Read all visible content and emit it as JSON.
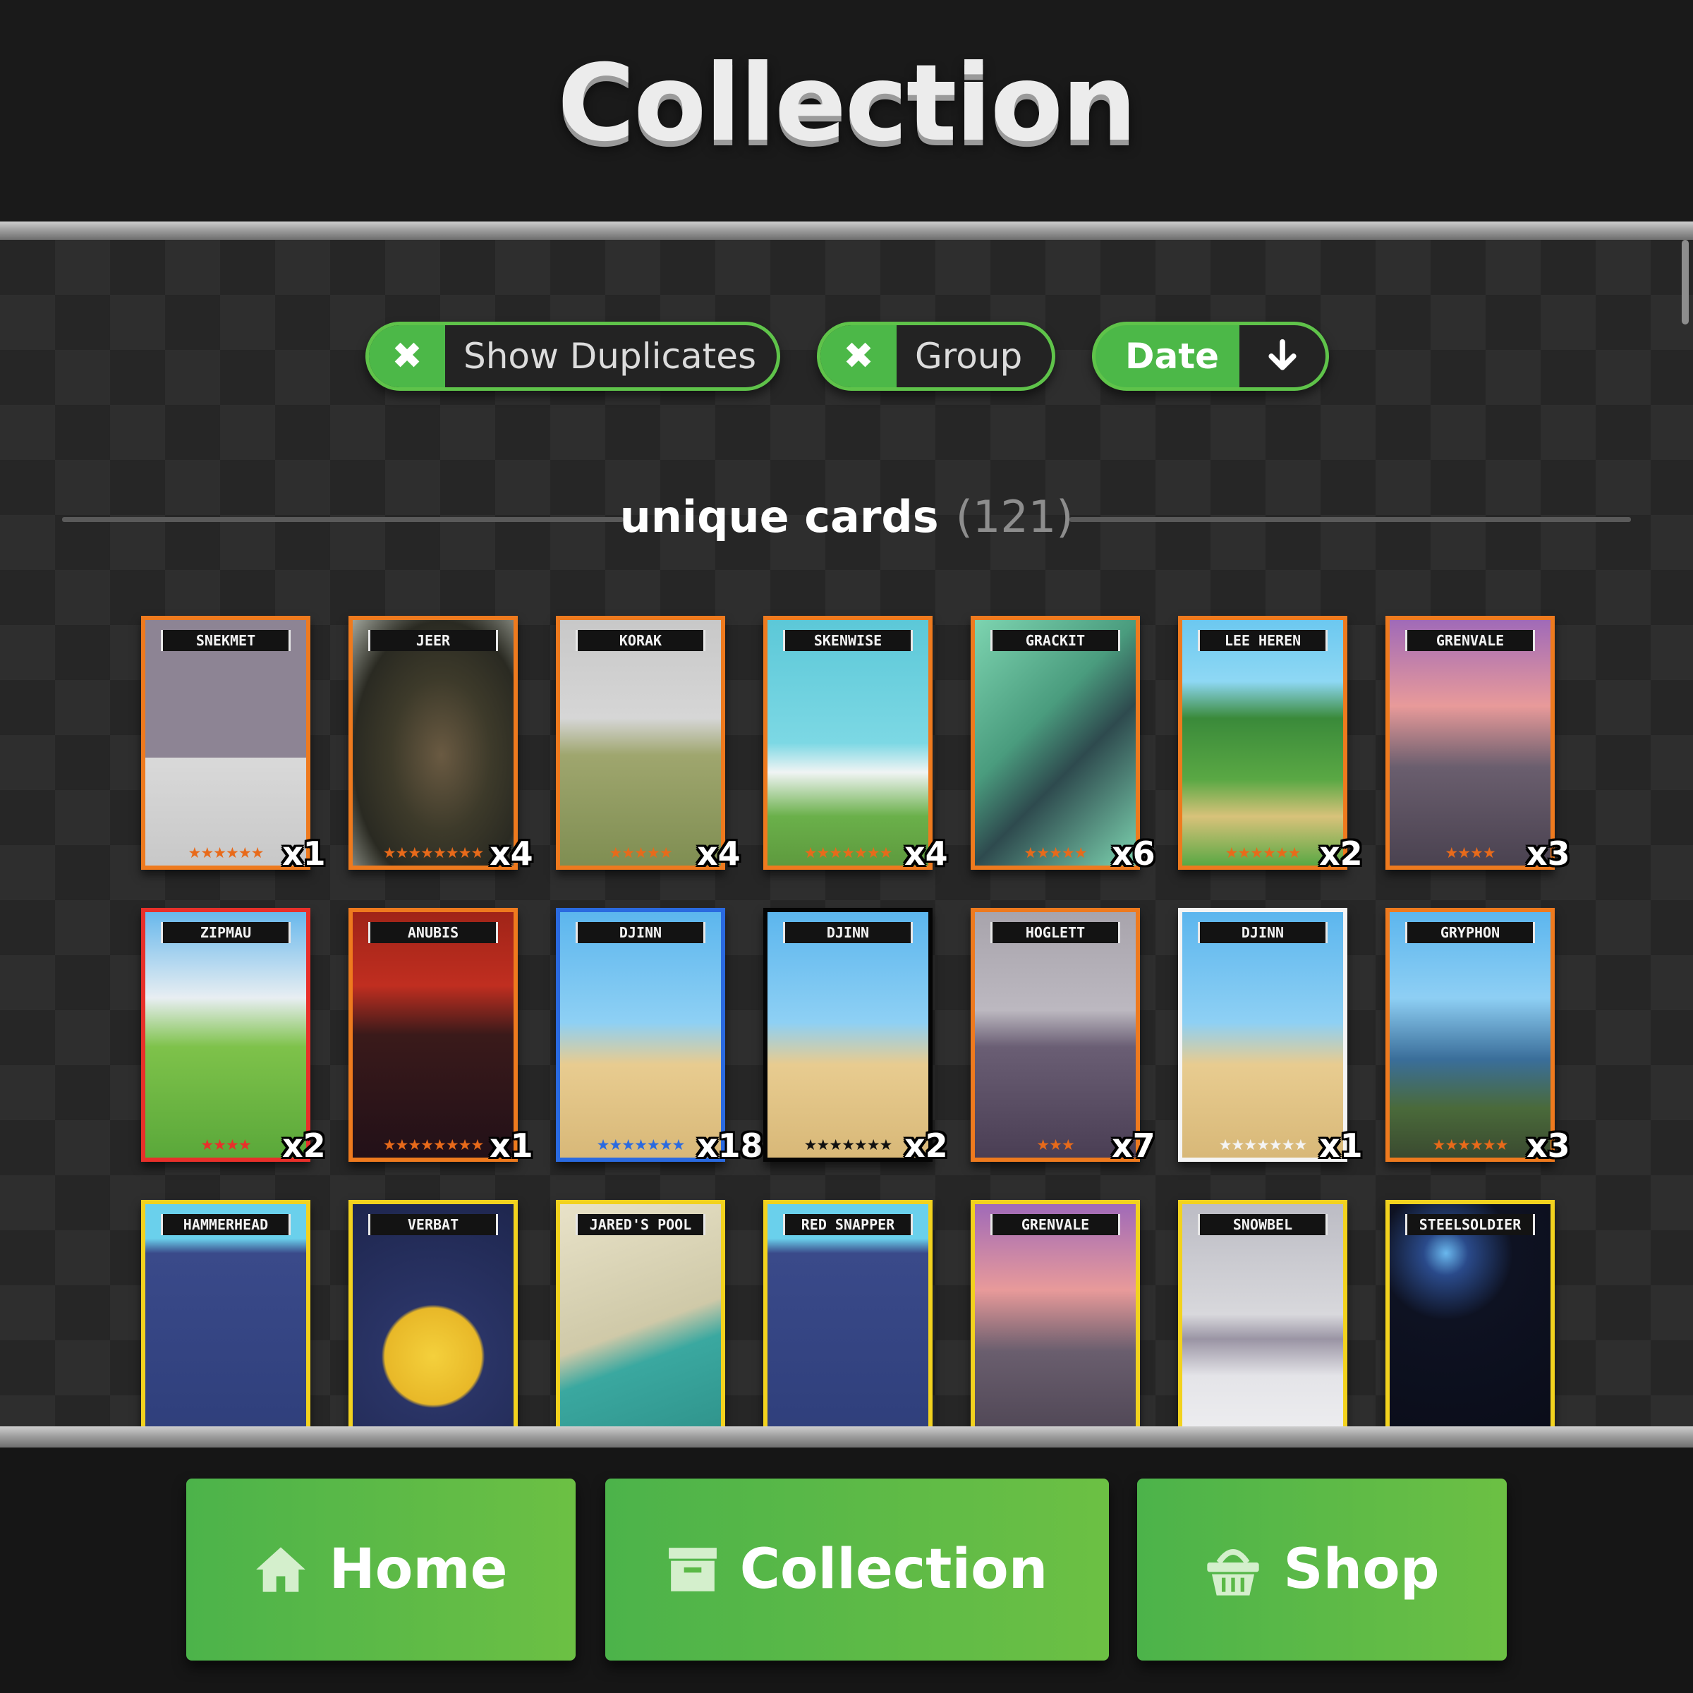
{
  "header": {
    "title": "Collection"
  },
  "filters": {
    "duplicates_label": "Show Duplicates",
    "group_label": "Group",
    "sort_label": "Date",
    "toggle_glyph": "✖",
    "sort_glyph": "🡓"
  },
  "section": {
    "title": "unique cards",
    "count": "(121)"
  },
  "cards": [
    {
      "name": "SNEKMET",
      "qty": "x1",
      "stars": "★★★★★★",
      "frame": "#ee7a1e",
      "star_color": "#e86a1a",
      "art": "linear-gradient(#8d8494 0%,#8d8494 56%,#d9d9d9 56%,#c8c8c8 100%)"
    },
    {
      "name": "JEER",
      "qty": "x4",
      "stars": "★★★★★★★★",
      "frame": "#ee7a1e",
      "star_color": "#e86a1a",
      "art": "radial-gradient(ellipse at 55% 55%,#6a5a42 0%,#3d3a2a 40%,#2a2a22 70%,#a0a49a 100%)"
    },
    {
      "name": "KORAK",
      "qty": "x4",
      "stars": "★★★★★",
      "frame": "#ee7a1e",
      "star_color": "#e86a1a",
      "art": "linear-gradient(#c8c8c8 0%,#d6d6d6 40%,#9fa66e 55%,#7f8e52 100%)"
    },
    {
      "name": "SKENWISE",
      "qty": "x4",
      "stars": "★★★★★★★",
      "frame": "#ee7a1e",
      "star_color": "#e86a1a",
      "art": "linear-gradient(#5cc8d8 0%,#7cd8e4 50%,#f0f4f4 62%,#6ab04a 80%,#5e9a3e 100%)"
    },
    {
      "name": "GRACKIT",
      "qty": "x6",
      "stars": "★★★★★",
      "frame": "#ee7a1e",
      "star_color": "#e86a1a",
      "art": "linear-gradient(135deg,#7dd4b0 0%,#4a9c7e 40%,#2e4a4e 60%,#7dd4b0 100%)"
    },
    {
      "name": "LEE HEREN",
      "qty": "x2",
      "stars": "★★★★★★",
      "frame": "#ee7a1e",
      "star_color": "#e86a1a",
      "art": "linear-gradient(#6cc8f0 0%,#8ed8f4 25%,#3a8a3a 40%,#5aa844 65%,#d8c27a 80%,#5aa844 100%)"
    },
    {
      "name": "GRENVALE",
      "qty": "x3",
      "stars": "★★★★",
      "frame": "#ee7a1e",
      "star_color": "#e86a1a",
      "art": "linear-gradient(#a06ab8 0%,#e89a9a 35%,#6a5e6e 60%,#4a4250 100%)"
    },
    {
      "name": "ZIPMAU",
      "qty": "x2",
      "stars": "★★★★",
      "frame": "#e8302a",
      "star_color": "#e8302a",
      "art": "linear-gradient(#68b8ec 0%,#e8eef2 35%,#7ec24a 55%,#5aa83a 100%)"
    },
    {
      "name": "ANUBIS",
      "qty": "x1",
      "stars": "★★★★★★★★",
      "frame": "#ee7a1e",
      "star_color": "#e86a1a",
      "art": "linear-gradient(#a02418 0%,#c02e20 30%,#3a1a1a 50%,#221018 100%)"
    },
    {
      "name": "DJINN",
      "qty": "x18",
      "stars": "★★★★★★★",
      "frame": "#2a6ae0",
      "star_color": "#2a6ae0",
      "art": "linear-gradient(#5cb6ee 0%,#8ed0f4 45%,#e8cc90 62%,#d8b878 100%)"
    },
    {
      "name": "DJINN",
      "qty": "x2",
      "stars": "★★★★★★★",
      "frame": "#050505",
      "star_color": "#111111",
      "art": "linear-gradient(#5cb6ee 0%,#8ed0f4 45%,#e8cc90 62%,#d8b878 100%)"
    },
    {
      "name": "HOGLETT",
      "qty": "x7",
      "stars": "★★★",
      "frame": "#ee7a1e",
      "star_color": "#e86a1a",
      "art": "linear-gradient(#a8a4ac 0%,#bcb8c0 40%,#6a5e74 55%,#4a3e54 100%)"
    },
    {
      "name": "DJINN",
      "qty": "x1",
      "stars": "★★★★★★★",
      "frame": "#f4f4f4",
      "star_color": "#f4f4f4",
      "art": "linear-gradient(#5cb6ee 0%,#8ed0f4 45%,#e8cc90 62%,#d8b878 100%)"
    },
    {
      "name": "GRYPHON",
      "qty": "x3",
      "stars": "★★★★★★",
      "frame": "#ee7a1e",
      "star_color": "#e86a1a",
      "art": "linear-gradient(#5cb6ee 0%,#8ecff4 35%,#3a6e9a 60%,#4a6a3a 80%,#3a4a30 100%)"
    },
    {
      "name": "HAMMERHEAD",
      "qty": "",
      "stars": "",
      "frame": "#f2d21e",
      "star_color": "#f2d21e",
      "art": "linear-gradient(#6ad0ec 0%,#6ad0ec 14%,#3a4a8a 20%,#2e3e7a 100%)"
    },
    {
      "name": "VERBAT",
      "qty": "",
      "stars": "",
      "frame": "#f2d21e",
      "star_color": "#f2d21e",
      "art": "radial-gradient(circle at 50% 62%,#f4d03c 0%,#e8b828 28%,#2a3466 30%,#1e264e 100%)"
    },
    {
      "name": "JARED'S POOL",
      "qty": "",
      "stars": "",
      "frame": "#f2d21e",
      "star_color": "#f2d21e",
      "art": "linear-gradient(160deg,#e8e2c8 0%,#cfc9a8 50%,#3aa8a0 62%,#2e9088 100%)"
    },
    {
      "name": "RED SNAPPER",
      "qty": "",
      "stars": "",
      "frame": "#f2d21e",
      "star_color": "#f2d21e",
      "art": "linear-gradient(#6ad0ec 0%,#6ad0ec 14%,#3a4a8a 20%,#2e3e7a 100%)"
    },
    {
      "name": "GRENVALE",
      "qty": "",
      "stars": "",
      "frame": "#f2d21e",
      "star_color": "#f2d21e",
      "art": "linear-gradient(#a06ab8 0%,#e89a9a 35%,#6a5e6e 60%,#4a4250 100%)"
    },
    {
      "name": "SNOWBEL",
      "qty": "",
      "stars": "",
      "frame": "#f2d21e",
      "star_color": "#f2d21e",
      "art": "linear-gradient(#bcbcc4 0%,#d8d8dc 45%,#9a94a4 55%,#e4e4e8 70%,#f0f0f2 100%)"
    },
    {
      "name": "STEELSOLDIER",
      "qty": "",
      "stars": "",
      "frame": "#f2d21e",
      "star_color": "#f2d21e",
      "art": "radial-gradient(circle at 35% 20%,#6ab8ee 0%,#2a4a8a 10%,#0e1222 30%,#0a0c18 100%)"
    }
  ],
  "nav": {
    "home": "Home",
    "collection": "Collection",
    "shop": "Shop"
  }
}
